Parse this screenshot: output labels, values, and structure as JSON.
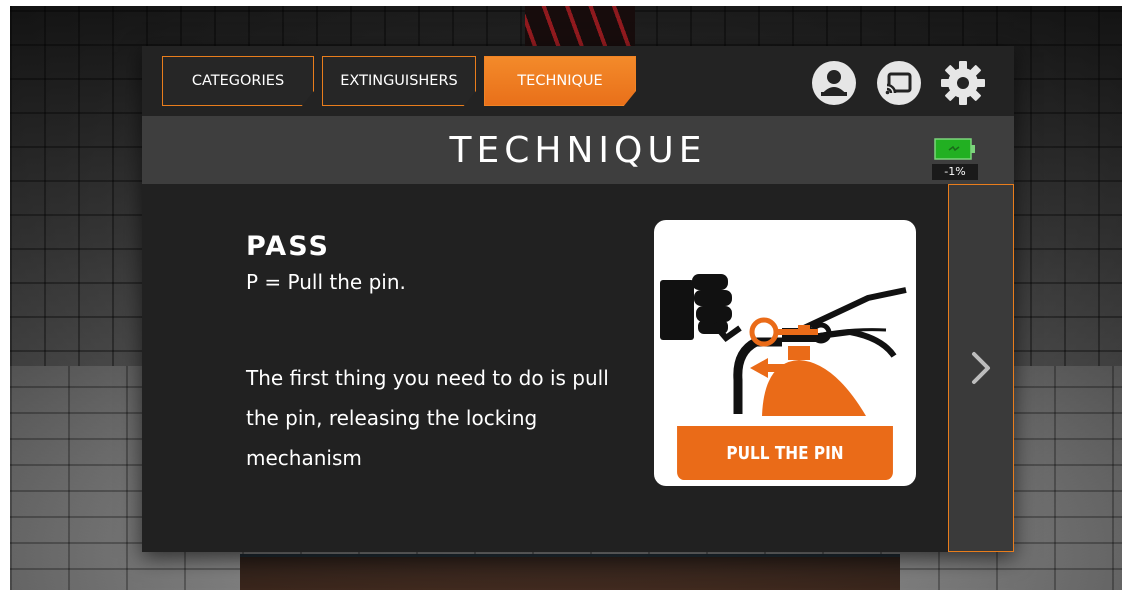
{
  "tabs": [
    {
      "label": "CATEGORIES",
      "active": false
    },
    {
      "label": "EXTINGUISHERS",
      "active": false
    },
    {
      "label": "TECHNIQUE",
      "active": true
    }
  ],
  "header_icons": [
    "user-icon",
    "cast-icon",
    "gear-icon"
  ],
  "title": "TECHNIQUE",
  "battery": {
    "label": "-1%",
    "color": "#22b022"
  },
  "content": {
    "heading": "PASS",
    "subheading": "P = Pull the pin.",
    "description": "The first thing you need to do is pull the pin, releasing the locking mechanism",
    "image_caption": "PULL THE PIN"
  },
  "next_icon": "chevron-right-icon",
  "colors": {
    "accent": "#e97d1c",
    "panel": "#212121",
    "title_bar": "#3e3e3e"
  }
}
